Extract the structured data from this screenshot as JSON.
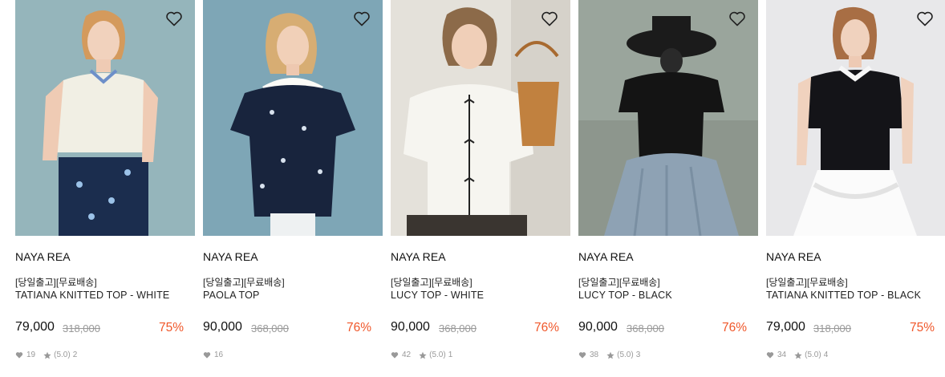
{
  "icons": {
    "wishlist": "heart-outline-icon",
    "likes": "heart-filled-icon",
    "rating": "star-icon"
  },
  "colors": {
    "discount": "#f0572a",
    "muted": "#999999"
  },
  "products": [
    {
      "brand": "NAYA REA",
      "tag": "[당일출고][무료배송]",
      "name": "TATIANA KNITTED TOP - WHITE",
      "price": "79,000",
      "original_price": "318,000",
      "discount": "75%",
      "likes": "19",
      "rating": "(5.0)",
      "reviews": "2"
    },
    {
      "brand": "NAYA REA",
      "tag": "[당일출고][무료배송]",
      "name": "PAOLA TOP",
      "price": "90,000",
      "original_price": "368,000",
      "discount": "76%",
      "likes": "16"
    },
    {
      "brand": "NAYA REA",
      "tag": "[당일출고][무료배송]",
      "name": "LUCY TOP - WHITE",
      "price": "90,000",
      "original_price": "368,000",
      "discount": "76%",
      "likes": "42",
      "rating": "(5.0)",
      "reviews": "1"
    },
    {
      "brand": "NAYA REA",
      "tag": "[당일출고][무료배송]",
      "name": "LUCY TOP - BLACK",
      "price": "90,000",
      "original_price": "368,000",
      "discount": "76%",
      "likes": "38",
      "rating": "(5.0)",
      "reviews": "3"
    },
    {
      "brand": "NAYA REA",
      "tag": "[당일출고][무료배송]",
      "name": "TATIANA KNITTED TOP - BLACK",
      "price": "79,000",
      "original_price": "318,000",
      "discount": "75%",
      "likes": "34",
      "rating": "(5.0)",
      "reviews": "4"
    }
  ]
}
